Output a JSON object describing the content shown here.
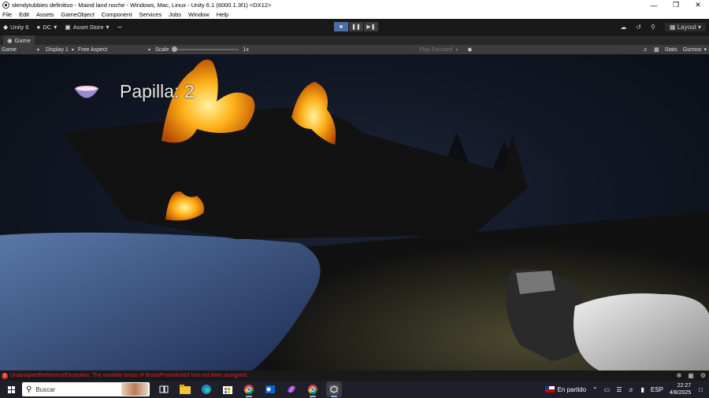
{
  "window": {
    "title": "slendytubbies  definitivo - Maind land noche - Windows, Mac, Linux - Unity 6.1 (6000.1.3f1) <DX12>",
    "controls": [
      "minimize-icon",
      "restore-icon",
      "close-icon"
    ]
  },
  "menu": {
    "items": [
      "File",
      "Edit",
      "Assets",
      "GameObject",
      "Component",
      "Services",
      "Jobs",
      "Window",
      "Help"
    ]
  },
  "toolbar": {
    "unity_label": "Unity 6",
    "account_label": "DC",
    "asset_store_label": "Asset Store",
    "layout_label": "Layout"
  },
  "tabs": [
    {
      "label": "Game"
    }
  ],
  "game_toolbar": {
    "view_label": "Game",
    "display_label": "Display 1",
    "aspect_label": "Free Aspect",
    "scale_label": "Scale",
    "scale_value": "1x",
    "play_focused_label": "Play Focused",
    "stats_label": "Stats",
    "gizmos_label": "Gizmos"
  },
  "hud": {
    "counter_text": "Papilla: 2",
    "icon": "bowl-icon"
  },
  "console": {
    "error_message": "UnassignedReferenceException: The variable brazo of BrazoProcedural3 has not been assigned."
  },
  "taskbar": {
    "search_placeholder": "Buscar",
    "weather_text": "En partido",
    "language": "ESP",
    "time": "22:27",
    "date": "4/8/2025"
  },
  "colors": {
    "editor_bg": "#191919",
    "error_red": "#e0322b",
    "play_active": "#4a6fa5"
  }
}
